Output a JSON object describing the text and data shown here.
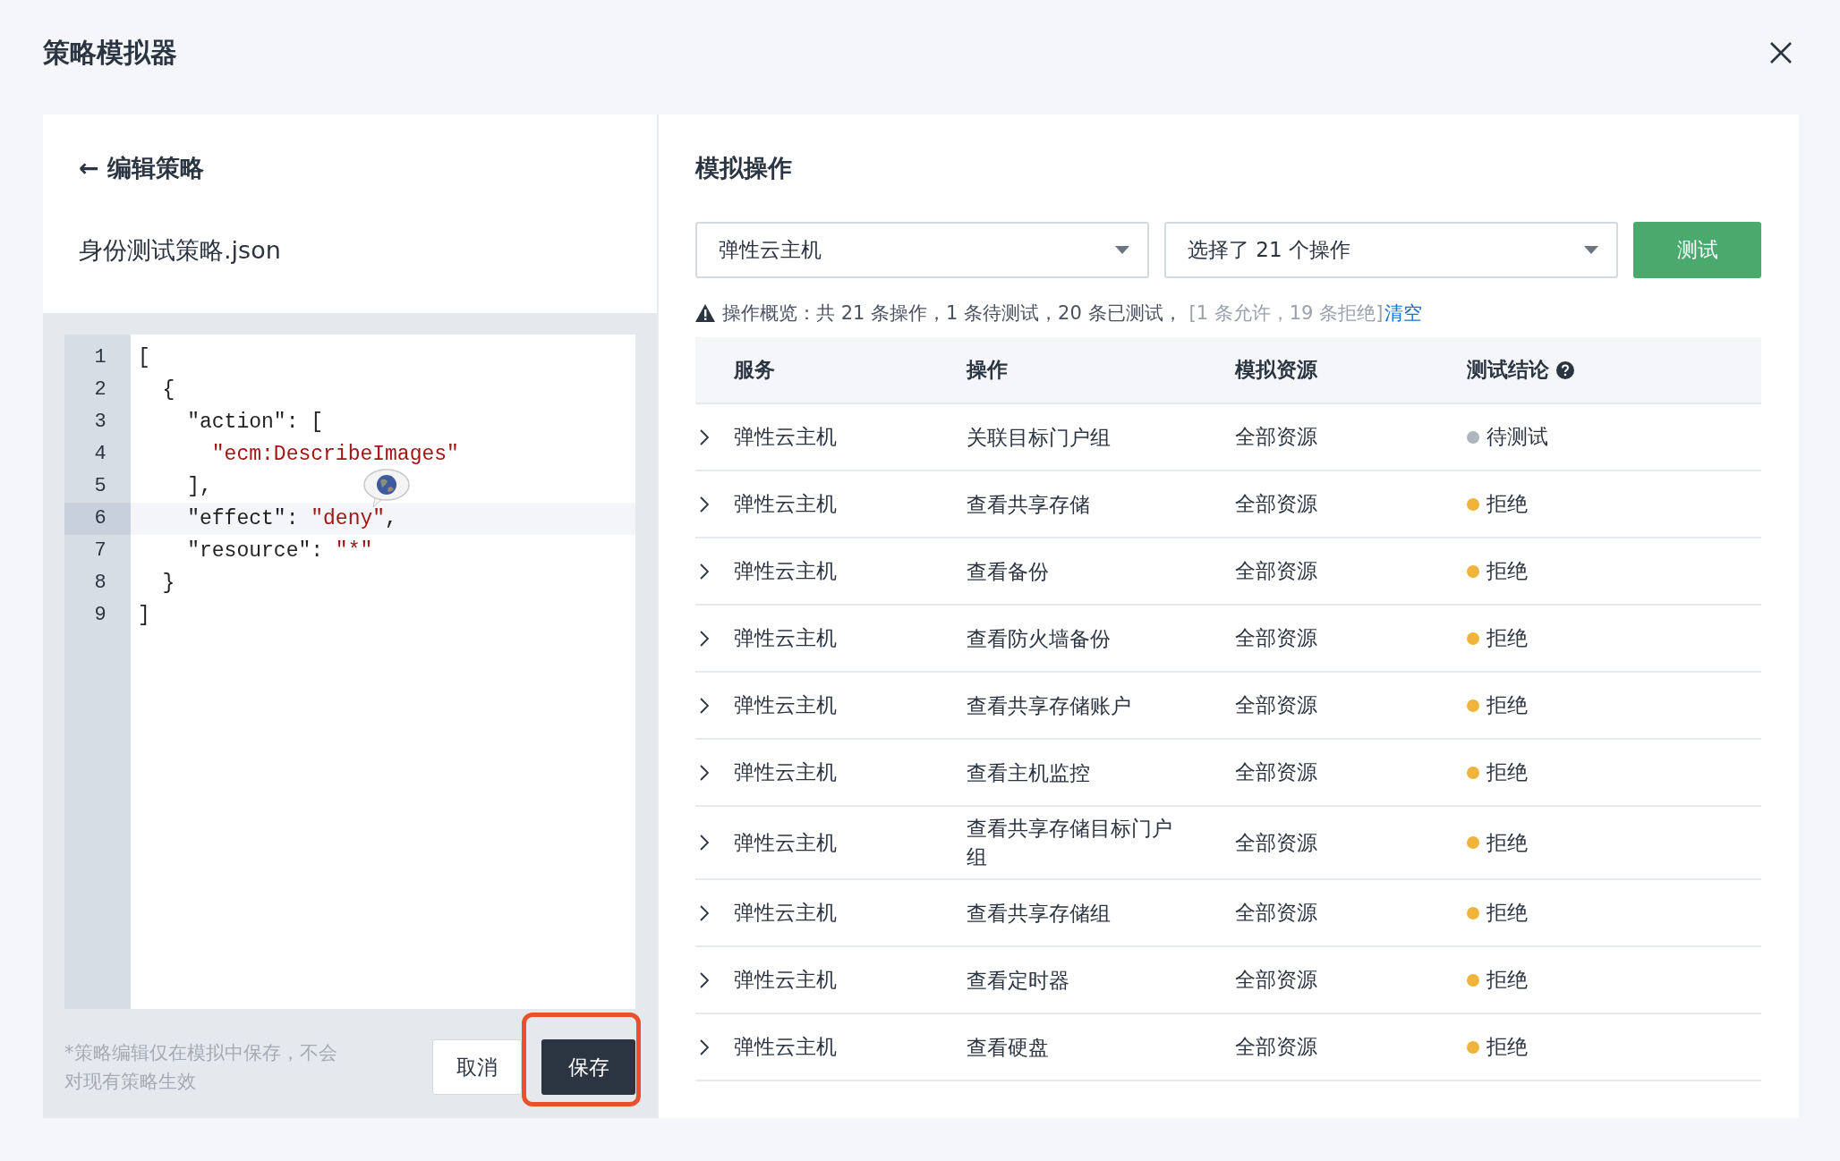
{
  "dialog": {
    "title": "策略模拟器"
  },
  "editor_panel": {
    "back_link": "← 编辑策略",
    "file_name": "身份测试策略.json",
    "code_lines": [
      {
        "number": "1",
        "highlighted": false,
        "tokens": [
          {
            "kind": "plain",
            "text": "["
          }
        ]
      },
      {
        "number": "2",
        "highlighted": false,
        "tokens": [
          {
            "kind": "plain",
            "text": "  {"
          }
        ]
      },
      {
        "number": "3",
        "highlighted": false,
        "tokens": [
          {
            "kind": "plain",
            "text": "    \"action\": ["
          }
        ]
      },
      {
        "number": "4",
        "highlighted": false,
        "tokens": [
          {
            "kind": "string",
            "text": "      \"ecm:DescribeImages\""
          }
        ]
      },
      {
        "number": "5",
        "highlighted": false,
        "tokens": [
          {
            "kind": "plain",
            "text": "    ],"
          }
        ]
      },
      {
        "number": "6",
        "highlighted": true,
        "tokens": [
          {
            "kind": "plain",
            "text": "    \"effect\": "
          },
          {
            "kind": "string",
            "text": "\"deny\""
          },
          {
            "kind": "plain",
            "text": ","
          }
        ]
      },
      {
        "number": "7",
        "highlighted": false,
        "tokens": [
          {
            "kind": "plain",
            "text": "    \"resource\": "
          },
          {
            "kind": "string",
            "text": "\"*\""
          }
        ]
      },
      {
        "number": "8",
        "highlighted": false,
        "tokens": [
          {
            "kind": "plain",
            "text": "  }"
          }
        ]
      },
      {
        "number": "9",
        "highlighted": false,
        "tokens": [
          {
            "kind": "plain",
            "text": "]"
          }
        ]
      }
    ],
    "note": "*策略编辑仅在模拟中保存，不会对现有策略生效",
    "buttons": [
      {
        "label": "取消",
        "kind": "secondary"
      },
      {
        "label": "保存",
        "kind": "primary",
        "highlighted": true
      }
    ]
  },
  "simulation_panel": {
    "heading": "模拟操作",
    "service_select": "弹性云主机",
    "action_select": "选择了 21 个操作",
    "test_button": "测试",
    "summary": {
      "text": "操作概览：共 21 条操作，1 条待测试，20 条已测试，",
      "detail": "[1 条允许，19 条拒绝]",
      "link": "清空"
    },
    "table": {
      "columns": [
        "服务",
        "操作",
        "模拟资源",
        "测试结论"
      ],
      "rows": [
        {
          "service": "弹性云主机",
          "operation": "关联目标门户组",
          "resource": "全部资源",
          "result": "待测试",
          "color": "#b0b6bf"
        },
        {
          "service": "弹性云主机",
          "operation": "查看共享存储",
          "resource": "全部资源",
          "result": "拒绝",
          "color": "#f0b43c"
        },
        {
          "service": "弹性云主机",
          "operation": "查看备份",
          "resource": "全部资源",
          "result": "拒绝",
          "color": "#f0b43c"
        },
        {
          "service": "弹性云主机",
          "operation": "查看防火墙备份",
          "resource": "全部资源",
          "result": "拒绝",
          "color": "#f0b43c"
        },
        {
          "service": "弹性云主机",
          "operation": "查看共享存储账户",
          "resource": "全部资源",
          "result": "拒绝",
          "color": "#f0b43c"
        },
        {
          "service": "弹性云主机",
          "operation": "查看主机监控",
          "resource": "全部资源",
          "result": "拒绝",
          "color": "#f0b43c"
        },
        {
          "service": "弹性云主机",
          "operation": "查看共享存储目标门户组",
          "resource": "全部资源",
          "result": "拒绝",
          "color": "#f0b43c"
        },
        {
          "service": "弹性云主机",
          "operation": "查看共享存储组",
          "resource": "全部资源",
          "result": "拒绝",
          "color": "#f0b43c"
        },
        {
          "service": "弹性云主机",
          "operation": "查看定时器",
          "resource": "全部资源",
          "result": "拒绝",
          "color": "#f0b43c"
        },
        {
          "service": "弹性云主机",
          "operation": "查看硬盘",
          "resource": "全部资源",
          "result": "拒绝",
          "color": "#f0b43c"
        }
      ]
    }
  }
}
